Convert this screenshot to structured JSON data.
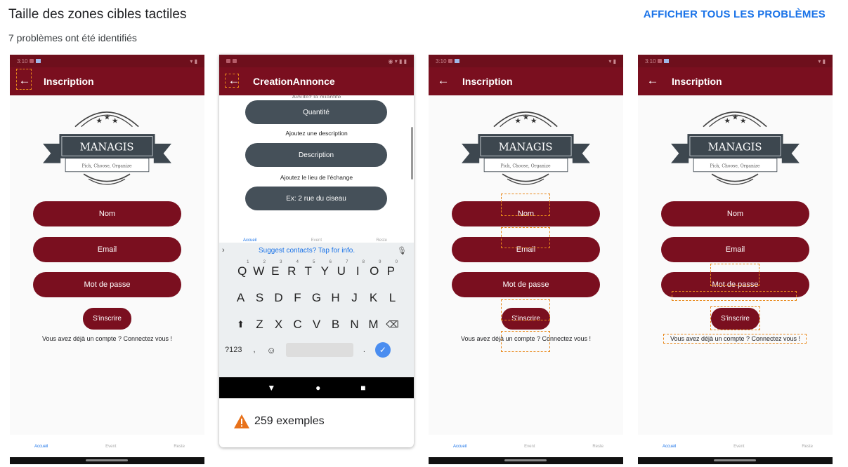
{
  "header": {
    "title": "Taille des zones cibles tactiles",
    "show_all_label": "AFFICHER TOUS LES PROBLÈMES",
    "subtitle": "7 problèmes ont été identifiés"
  },
  "colors": {
    "primary": "#7a0f1f",
    "accent": "#1a73e8",
    "highlight": "#e8881a",
    "dark_pill": "#455059"
  },
  "logo": {
    "brand": "MANAGIS",
    "tagline": "Pick, Choose, Organize"
  },
  "phone1": {
    "status_time": "3:10",
    "appbar_title": "Inscription",
    "fields": [
      "Nom",
      "Email",
      "Mot de passe"
    ],
    "submit": "S'inscrire",
    "login_text": "Vous avez déjà un compte ? Connectez vous !",
    "nav": [
      "Accueil",
      "Event",
      "Reste"
    ]
  },
  "phone2": {
    "appbar_title": "CreationAnnonce",
    "cut_caption": "Ajoutez la quantité",
    "buttons": [
      "Quantité",
      "Description",
      "Ex: 2 rue du ciseau"
    ],
    "captions": [
      "Ajoutez une description",
      "Ajoutez le lieu de l'échange"
    ],
    "nav": [
      "Accueil",
      "Event",
      "Reste"
    ],
    "suggestion": "Suggest contacts? Tap for info.",
    "row1": [
      "Q",
      "W",
      "E",
      "R",
      "T",
      "Y",
      "U",
      "I",
      "O",
      "P"
    ],
    "row1_digits": [
      "1",
      "2",
      "3",
      "4",
      "5",
      "6",
      "7",
      "8",
      "9",
      "0"
    ],
    "row2": [
      "A",
      "S",
      "D",
      "F",
      "G",
      "H",
      "J",
      "K",
      "L"
    ],
    "row3": [
      "Z",
      "X",
      "C",
      "V",
      "B",
      "N",
      "M"
    ],
    "sym_key": "?123",
    "comma": ",",
    "period": ".",
    "examples": "259 exemples"
  },
  "phone3": {
    "status_time": "3:10",
    "appbar_title": "Inscription",
    "fields": [
      "Nom",
      "Email",
      "Mot de passe"
    ],
    "submit": "S'inscrire",
    "login_text": "Vous avez déjà un compte ? Connectez vous !",
    "nav": [
      "Accueil",
      "Event",
      "Reste"
    ]
  },
  "phone4": {
    "status_time": "3:10",
    "appbar_title": "Inscription",
    "fields": [
      "Nom",
      "Email",
      "Mot de passe"
    ],
    "submit": "S'inscrire",
    "login_text": "Vous avez déjà un compte ? Connectez vous !",
    "nav": [
      "Accueil",
      "Event",
      "Reste"
    ]
  }
}
